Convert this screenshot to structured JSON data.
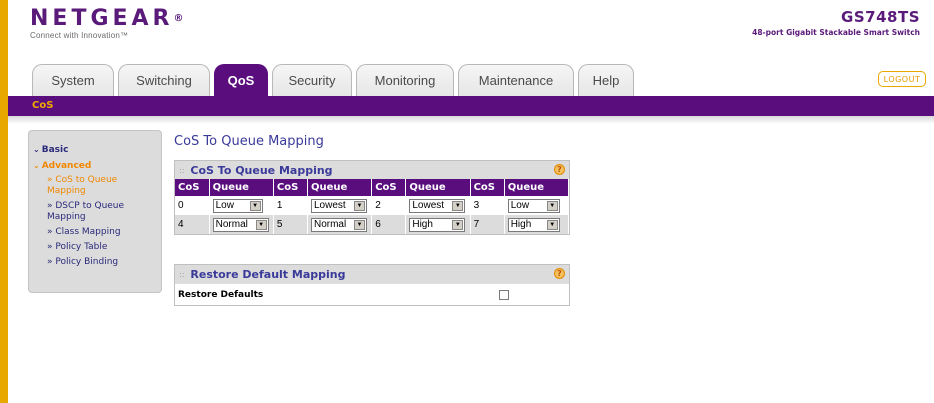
{
  "header": {
    "logo_text": "NETGEAR",
    "logo_registered": "®",
    "logo_tagline": "Connect with Innovation™",
    "product_model": "GS748TS",
    "product_desc": "48-port Gigabit Stackable Smart Switch"
  },
  "tabs": [
    {
      "label": "System",
      "active": false
    },
    {
      "label": "Switching",
      "active": false
    },
    {
      "label": "QoS",
      "active": true
    },
    {
      "label": "Security",
      "active": false
    },
    {
      "label": "Monitoring",
      "active": false
    },
    {
      "label": "Maintenance",
      "active": false
    },
    {
      "label": "Help",
      "active": false
    }
  ],
  "logout_label": "LOGOUT",
  "subnav": {
    "label": "CoS"
  },
  "sidebar": {
    "basic": "Basic",
    "advanced": "Advanced",
    "items": [
      {
        "label": "» CoS to Queue Mapping",
        "active": true
      },
      {
        "label": "» DSCP to Queue Mapping",
        "active": false
      },
      {
        "label": "» Class Mapping",
        "active": false
      },
      {
        "label": "» Policy Table",
        "active": false
      },
      {
        "label": "» Policy Binding",
        "active": false
      }
    ]
  },
  "main": {
    "page_title": "CoS To Queue Mapping",
    "mapping_panel": {
      "title": "CoS To Queue Mapping",
      "col_cos": "CoS",
      "col_queue": "Queue",
      "rows": [
        [
          {
            "cos": "0",
            "queue": "Low"
          },
          {
            "cos": "1",
            "queue": "Lowest"
          },
          {
            "cos": "2",
            "queue": "Lowest"
          },
          {
            "cos": "3",
            "queue": "Low"
          }
        ],
        [
          {
            "cos": "4",
            "queue": "Normal"
          },
          {
            "cos": "5",
            "queue": "Normal"
          },
          {
            "cos": "6",
            "queue": "High"
          },
          {
            "cos": "7",
            "queue": "High"
          }
        ]
      ]
    },
    "restore_panel": {
      "title": "Restore Default Mapping",
      "restore_label": "Restore Defaults",
      "checked": false
    },
    "help_glyph": "?"
  },
  "colors": {
    "brand_purple": "#5a0e7e",
    "accent_orange": "#f08800",
    "title_blue": "#3a3a9a"
  }
}
